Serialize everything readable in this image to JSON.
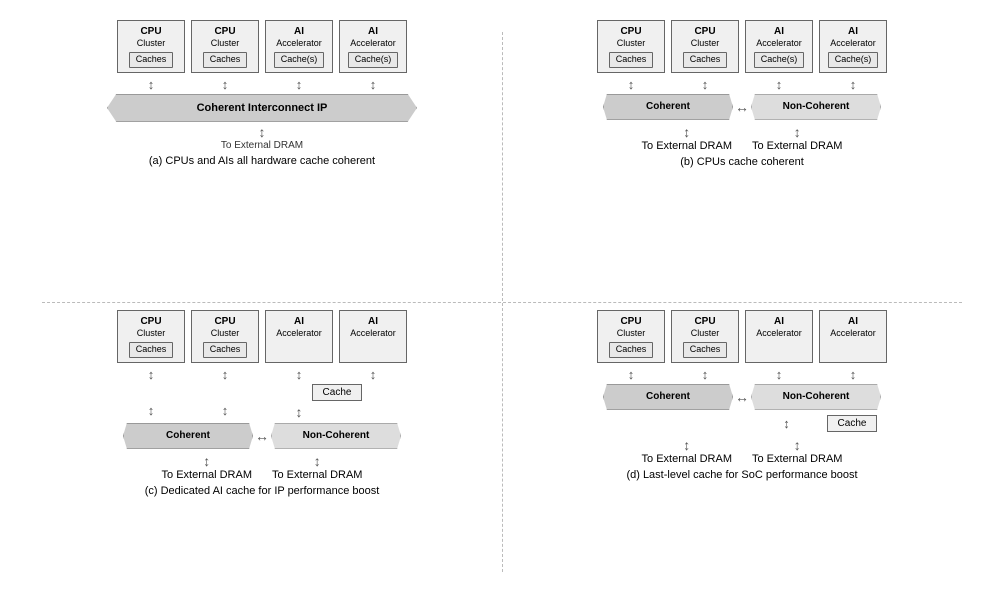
{
  "diagrams": {
    "a": {
      "caption": "(a) CPUs and AIs all hardware cache coherent",
      "units": [
        {
          "title": "CPU",
          "sub": "Cluster",
          "cache": "Caches"
        },
        {
          "title": "CPU",
          "sub": "Cluster",
          "cache": "Caches"
        },
        {
          "title": "AI",
          "sub": "Accelerator",
          "cache": "Cache(s)"
        },
        {
          "title": "AI",
          "sub": "Accelerator",
          "cache": "Cache(s)"
        }
      ],
      "interconnect": "Coherent Interconnect IP",
      "dram": "To External DRAM"
    },
    "b": {
      "caption": "(b) CPUs cache coherent",
      "units": [
        {
          "title": "CPU",
          "sub": "Cluster",
          "cache": "Caches"
        },
        {
          "title": "CPU",
          "sub": "Cluster",
          "cache": "Caches"
        },
        {
          "title": "AI",
          "sub": "Accelerator",
          "cache": "Cache(s)"
        },
        {
          "title": "AI",
          "sub": "Accelerator",
          "cache": "Cache(s)"
        }
      ],
      "coherent": "Coherent",
      "noncoherent": "Non-Coherent",
      "dram_left": "To External DRAM",
      "dram_right": "To External DRAM"
    },
    "c": {
      "caption": "(c) Dedicated AI cache for IP performance boost",
      "units": [
        {
          "title": "CPU",
          "sub": "Cluster",
          "cache": "Caches"
        },
        {
          "title": "CPU",
          "sub": "Cluster",
          "cache": "Caches"
        },
        {
          "title": "AI",
          "sub": "Accelerator",
          "cache": null
        },
        {
          "title": "AI",
          "sub": "Accelerator",
          "cache": null
        }
      ],
      "ai_cache": "Cache",
      "coherent": "Coherent",
      "noncoherent": "Non-Coherent",
      "dram_left": "To External DRAM",
      "dram_right": "To External DRAM"
    },
    "d": {
      "caption": "(d) Last-level cache for SoC performance boost",
      "units": [
        {
          "title": "CPU",
          "sub": "Cluster",
          "cache": "Caches"
        },
        {
          "title": "CPU",
          "sub": "Cluster",
          "cache": "Caches"
        },
        {
          "title": "AI",
          "sub": "Accelerator",
          "cache": null
        },
        {
          "title": "AI",
          "sub": "Accelerator",
          "cache": null
        }
      ],
      "coherent": "Coherent",
      "noncoherent": "Non-Coherent",
      "shared_cache": "Cache",
      "dram_left": "To External DRAM",
      "dram_right": "To External DRAM"
    }
  }
}
